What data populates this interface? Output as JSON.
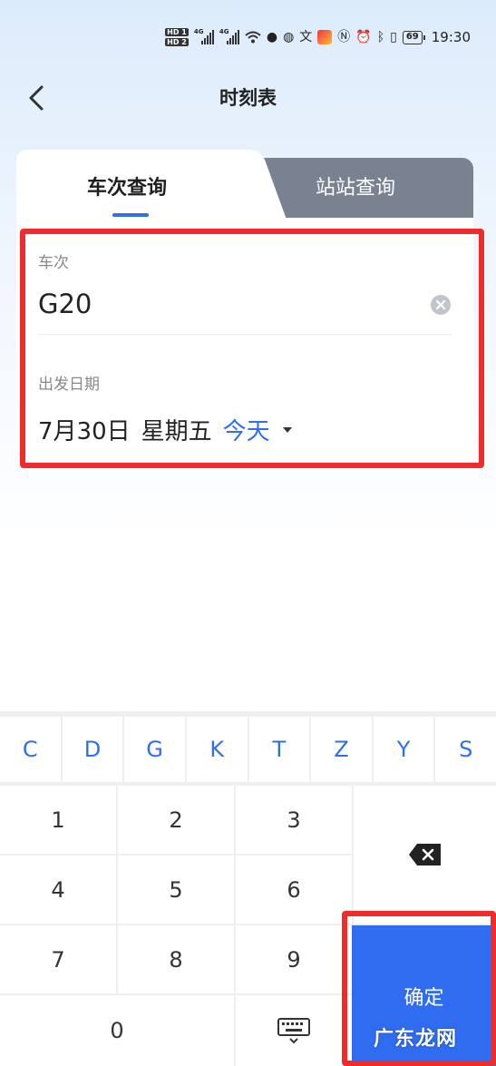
{
  "status_bar": {
    "hd1": "HD 1",
    "hd2": "HD 2",
    "net1": "4G",
    "net2": "4G",
    "battery": "69",
    "time": "19:30"
  },
  "nav": {
    "title": "时刻表"
  },
  "tabs": [
    {
      "label": "车次查询",
      "active": true
    },
    {
      "label": "站站查询",
      "active": false
    }
  ],
  "form": {
    "train_label": "车次",
    "train_value": "G20",
    "date_label": "出发日期",
    "date_value": "7月30日",
    "weekday": "星期五",
    "relative_day": "今天"
  },
  "keyboard": {
    "letters": [
      "C",
      "D",
      "G",
      "K",
      "T",
      "Z",
      "Y",
      "S"
    ],
    "digits": [
      "1",
      "2",
      "3",
      "4",
      "5",
      "6",
      "7",
      "8",
      "9",
      "0"
    ],
    "confirm_label": "确定"
  },
  "watermark": "广东龙网",
  "colors": {
    "accent": "#2f6fea",
    "highlight": "#f02b2b",
    "confirm": "#2f6cf0"
  }
}
